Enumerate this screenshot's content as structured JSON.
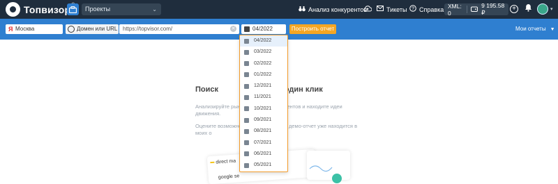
{
  "topbar": {
    "logo_text": "Топвизор",
    "logo_reg": "®",
    "project_select": "Проекты",
    "nav": [
      {
        "icon": "binoculars-icon",
        "label": "Анализ конкурентов"
      },
      {
        "icon": "cloud-upload-icon",
        "label": ""
      },
      {
        "icon": "envelope-icon",
        "label": "Тикеты"
      },
      {
        "icon": "help-circle-icon",
        "label": "Справка"
      }
    ],
    "xml_label": "XML: 0",
    "balance": "9 195.58 ₽"
  },
  "toolbar": {
    "region": "Москва",
    "domain_mode": "Домен или URL",
    "url_value": "https://topvisor.com/",
    "date_value": "04/2022",
    "build_button": "Построить отчет",
    "my_reports": "Мои отчеты"
  },
  "main": {
    "headline": "Поиск                       ка в один клик",
    "sub1": "Анализируйте рын                     конкурентов и находите идеи                              движения.",
    "sub2": "Оцените возможно                     льный демо-отчет уже находится в моих о                   нем углу страницы.",
    "preview_rows": [
      "direct ma",
      "google se"
    ]
  },
  "dropdown": {
    "items": [
      "04/2022",
      "03/2022",
      "02/2022",
      "01/2022",
      "12/2021",
      "11/2021",
      "10/2021",
      "09/2021",
      "08/2021",
      "07/2021",
      "06/2021",
      "05/2021"
    ],
    "selected": "04/2022"
  },
  "colors": {
    "topbar": "#1f2d3d",
    "toolbar": "#2f7fd0",
    "accent_orange": "#f5a623",
    "dropdown_border": "#f29b2b"
  }
}
